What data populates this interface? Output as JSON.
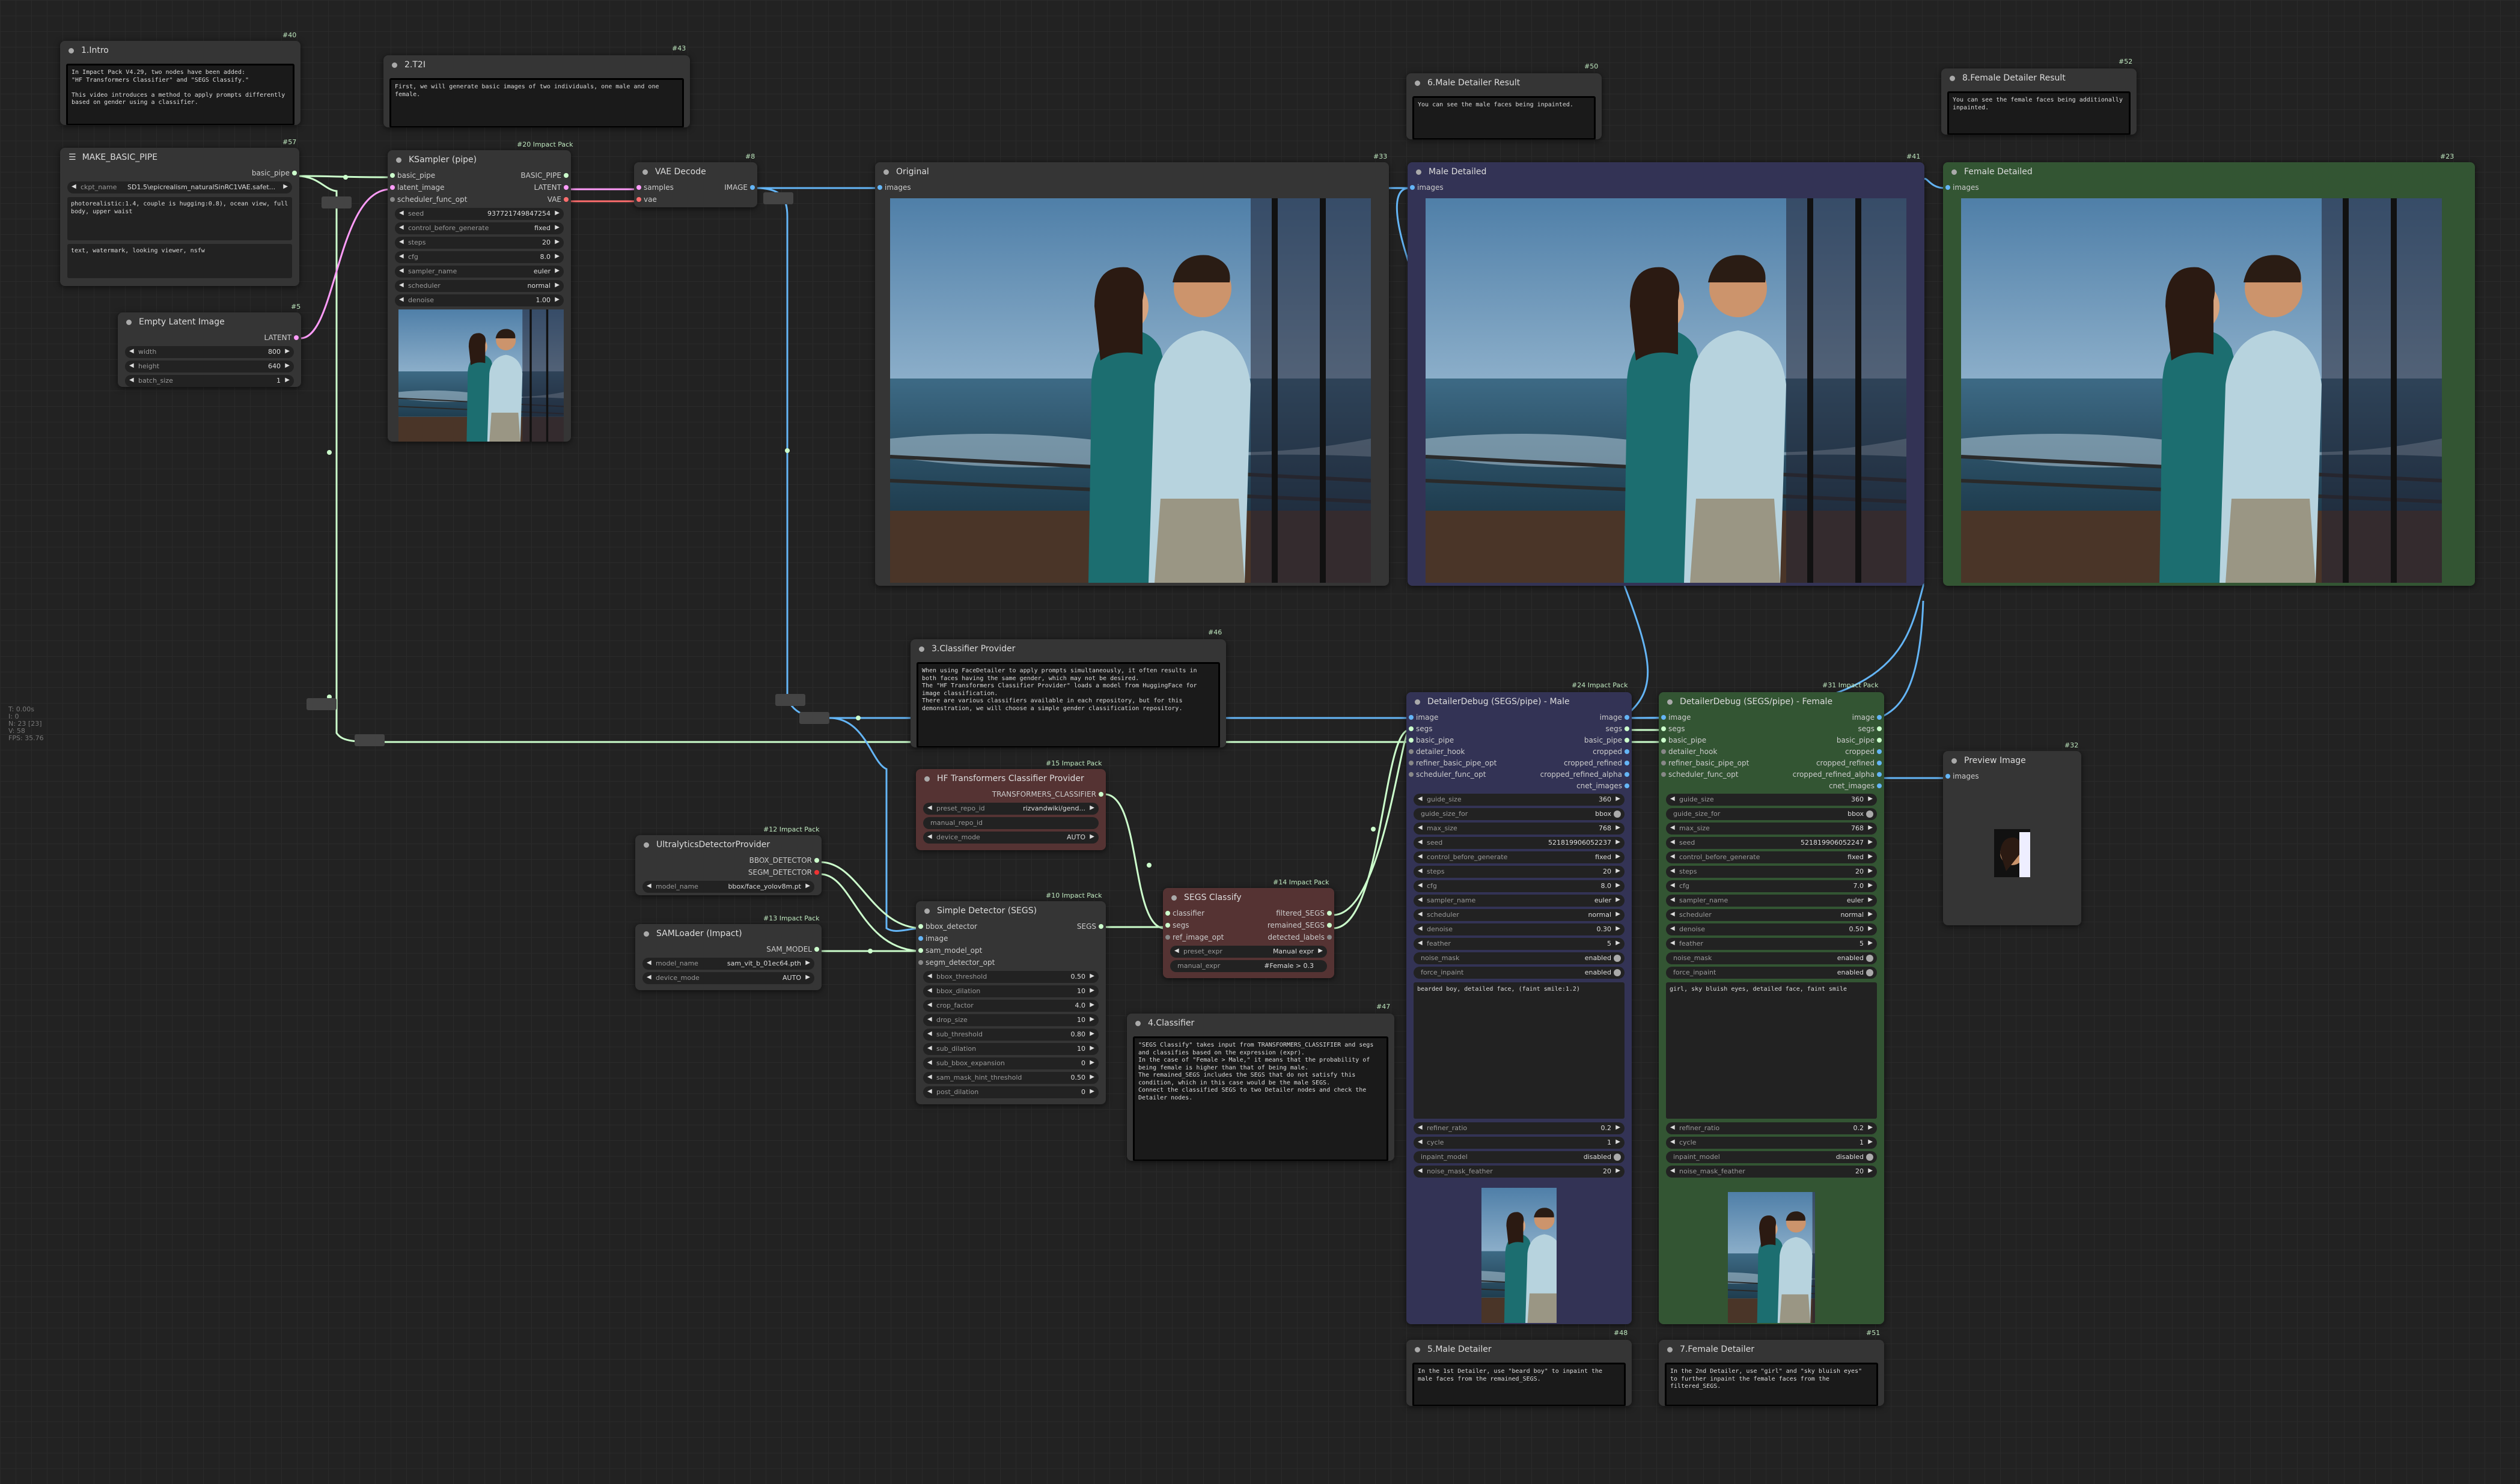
{
  "colors": {
    "canvas": "#222222",
    "node": "#353535",
    "male_group": "#333355",
    "female_group": "#335533",
    "red_node": "#553333",
    "wire_image": "#64b5f6",
    "wire_latent": "#ff9cf9",
    "wire_pipe": "#ccffcc",
    "wire_vae": "#ff6e6e"
  },
  "sidebar_stats": [
    "T: 0.00s",
    "I: 0",
    "N: 23 [23]",
    "V: 58",
    "FPS: 35.76"
  ],
  "notes": {
    "intro": {
      "title": "1.Intro",
      "id": "#40",
      "text": "In Impact Pack V4.29, two nodes have been added:\n\"HF Transformers Classifier\" and \"SEGS Classify.\"\n\nThis video introduces a method to apply prompts differently based on gender using a classifier."
    },
    "t2i": {
      "title": "2.T2I",
      "id": "#43",
      "text": "First, we will generate basic images of two individuals, one male and one female."
    },
    "male_result": {
      "title": "6.Male Detailer Result",
      "id": "#50",
      "text": "You can see the male faces being inpainted."
    },
    "female_result": {
      "title": "8.Female Detailer Result",
      "id": "#52",
      "text": "You can see the female faces being additionally inpainted."
    },
    "classifier_provider": {
      "title": "3.Classifier Provider",
      "id": "#46",
      "text": "When using FaceDetailer to apply prompts simultaneously, it often results in both faces having the same gender, which may not be desired.\nThe \"HF Transformers Classifier Provider\" loads a model from HuggingFace for image classification.\nThere are various classifiers available in each repository, but for this demonstration, we will choose a simple gender classification repository."
    },
    "classifier": {
      "title": "4.Classifier",
      "id": "#47",
      "text": "\"SEGS Classify\" takes input from TRANSFORMERS_CLASSIFIER and segs and classifies based on the expression (expr).\nIn the case of \"Female > Male,\" it means that the probability of being female is higher than that of being male.\nThe remained_SEGS includes the SEGS that do not satisfy this condition, which in this case would be the male SEGS.\nConnect the classified SEGS to two Detailer nodes and check the Detailer nodes."
    },
    "male_detailer": {
      "title": "5.Male Detailer",
      "id": "#48",
      "text": "In the 1st Detailer, use \"beard boy\" to inpaint the male faces from the remained_SEGS."
    },
    "female_detailer": {
      "title": "7.Female Detailer",
      "id": "#51",
      "text": "In the 2nd Detailer, use \"girl\" and \"sky bluish eyes\" to further inpaint the female faces from the filtered_SEGS."
    }
  },
  "make_basic_pipe": {
    "title": "MAKE_BASIC_PIPE",
    "id": "#57",
    "output": "basic_pipe",
    "ckpt_label": "ckpt_name",
    "ckpt_value": "SD1.5\\epicrealism_naturalSinRC1VAE.safet...",
    "positive": "photorealistic:1.4, couple is hugging:0.8), ocean view, full body, upper waist",
    "negative": "text, watermark, looking viewer, nsfw"
  },
  "empty_latent": {
    "title": "Empty Latent Image",
    "id": "#5",
    "output": "LATENT",
    "widgets": [
      [
        "width",
        "800"
      ],
      [
        "height",
        "640"
      ],
      [
        "batch_size",
        "1"
      ]
    ]
  },
  "ksampler": {
    "title": "KSampler (pipe)",
    "id": "#20 Impact Pack",
    "inputs": [
      "basic_pipe",
      "latent_image",
      "scheduler_func_opt"
    ],
    "outputs": [
      "BASIC_PIPE",
      "LATENT",
      "VAE"
    ],
    "widgets": [
      [
        "seed",
        "937721749847254"
      ],
      [
        "control_before_generate",
        "fixed"
      ],
      [
        "steps",
        "20"
      ],
      [
        "cfg",
        "8.0"
      ],
      [
        "sampler_name",
        "euler"
      ],
      [
        "scheduler",
        "normal"
      ],
      [
        "denoise",
        "1.00"
      ]
    ]
  },
  "vae_decode": {
    "title": "VAE Decode",
    "id": "#8",
    "inputs": [
      "samples",
      "vae"
    ],
    "output": "IMAGE"
  },
  "original": {
    "title": "Original",
    "id": "#33",
    "input": "images"
  },
  "male_detailed": {
    "title": "Male Detailed",
    "id": "#41",
    "input": "images"
  },
  "female_detailed": {
    "title": "Female Detailed",
    "id": "#23",
    "input": "images"
  },
  "hf_provider": {
    "title": "HF Transformers Classifier Provider",
    "id": "#15 Impact Pack",
    "output": "TRANSFORMERS_CLASSIFIER",
    "widgets": [
      [
        "preset_repo_id",
        "rizvandwiki/gend..."
      ],
      [
        "manual_repo_id",
        ""
      ],
      [
        "device_mode",
        "AUTO"
      ]
    ]
  },
  "ultralytics": {
    "title": "UltralyticsDetectorProvider",
    "id": "#12 Impact Pack",
    "outputs": [
      "BBOX_DETECTOR",
      "SEGM_DETECTOR"
    ],
    "widgets": [
      [
        "model_name",
        "bbox/face_yolov8m.pt"
      ]
    ]
  },
  "samloader": {
    "title": "SAMLoader (Impact)",
    "id": "#13 Impact Pack",
    "output": "SAM_MODEL",
    "widgets": [
      [
        "model_name",
        "sam_vit_b_01ec64.pth"
      ],
      [
        "device_mode",
        "AUTO"
      ]
    ]
  },
  "simple_detector": {
    "title": "Simple Detector (SEGS)",
    "id": "#10 Impact Pack",
    "inputs": [
      "bbox_detector",
      "image",
      "sam_model_opt",
      "segm_detector_opt"
    ],
    "output": "SEGS",
    "widgets": [
      [
        "bbox_threshold",
        "0.50"
      ],
      [
        "bbox_dilation",
        "10"
      ],
      [
        "crop_factor",
        "4.0"
      ],
      [
        "drop_size",
        "10"
      ],
      [
        "sub_threshold",
        "0.80"
      ],
      [
        "sub_dilation",
        "10"
      ],
      [
        "sub_bbox_expansion",
        "0"
      ],
      [
        "sam_mask_hint_threshold",
        "0.50"
      ],
      [
        "post_dilation",
        "0"
      ]
    ]
  },
  "segs_classify": {
    "title": "SEGS Classify",
    "id": "#14 Impact Pack",
    "inputs": [
      "classifier",
      "segs",
      "ref_image_opt"
    ],
    "outputs": [
      "filtered_SEGS",
      "remained_SEGS",
      "detected_labels"
    ],
    "widgets": [
      [
        "preset_expr",
        "Manual expr"
      ],
      [
        "manual_expr",
        "#Female > 0.3"
      ]
    ]
  },
  "detailer_male": {
    "title": "DetailerDebug (SEGS/pipe) - Male",
    "id": "#24 Impact Pack",
    "inputs": [
      "image",
      "segs",
      "basic_pipe",
      "detailer_hook",
      "refiner_basic_pipe_opt",
      "scheduler_func_opt"
    ],
    "outputs": [
      "image",
      "segs",
      "basic_pipe",
      "cropped",
      "cropped_refined",
      "cropped_refined_alpha",
      "cnet_images"
    ],
    "widgets": [
      [
        "guide_size",
        "360"
      ],
      [
        "guide_size_for",
        "bbox",
        "tog"
      ],
      [
        "max_size",
        "768"
      ],
      [
        "seed",
        "521819906052237"
      ],
      [
        "control_before_generate",
        "fixed"
      ],
      [
        "steps",
        "20"
      ],
      [
        "cfg",
        "8.0"
      ],
      [
        "sampler_name",
        "euler"
      ],
      [
        "scheduler",
        "normal"
      ],
      [
        "denoise",
        "0.30"
      ],
      [
        "feather",
        "5"
      ],
      [
        "noise_mask",
        "enabled",
        "tog"
      ],
      [
        "force_inpaint",
        "enabled",
        "tog"
      ]
    ],
    "prompt": "bearded boy, detailed face, (faint smile:1.2)",
    "widgets2": [
      [
        "refiner_ratio",
        "0.2"
      ],
      [
        "cycle",
        "1"
      ],
      [
        "inpaint_model",
        "disabled",
        "tog"
      ],
      [
        "noise_mask_feather",
        "20"
      ]
    ]
  },
  "detailer_female": {
    "title": "DetailerDebug (SEGS/pipe) - Female",
    "id": "#31 Impact Pack",
    "inputs": [
      "image",
      "segs",
      "basic_pipe",
      "detailer_hook",
      "refiner_basic_pipe_opt",
      "scheduler_func_opt"
    ],
    "outputs": [
      "image",
      "segs",
      "basic_pipe",
      "cropped",
      "cropped_refined",
      "cropped_refined_alpha",
      "cnet_images"
    ],
    "widgets": [
      [
        "guide_size",
        "360"
      ],
      [
        "guide_size_for",
        "bbox",
        "tog"
      ],
      [
        "max_size",
        "768"
      ],
      [
        "seed",
        "521819906052247"
      ],
      [
        "control_before_generate",
        "fixed"
      ],
      [
        "steps",
        "20"
      ],
      [
        "cfg",
        "7.0"
      ],
      [
        "sampler_name",
        "euler"
      ],
      [
        "scheduler",
        "normal"
      ],
      [
        "denoise",
        "0.50"
      ],
      [
        "feather",
        "5"
      ],
      [
        "noise_mask",
        "enabled",
        "tog"
      ],
      [
        "force_inpaint",
        "enabled",
        "tog"
      ]
    ],
    "prompt": "girl, sky bluish eyes, detailed face, faint smile",
    "widgets2": [
      [
        "refiner_ratio",
        "0.2"
      ],
      [
        "cycle",
        "1"
      ],
      [
        "inpaint_model",
        "disabled",
        "tog"
      ],
      [
        "noise_mask_feather",
        "20"
      ]
    ]
  },
  "preview": {
    "title": "Preview Image",
    "id": "#32",
    "input": "images"
  }
}
